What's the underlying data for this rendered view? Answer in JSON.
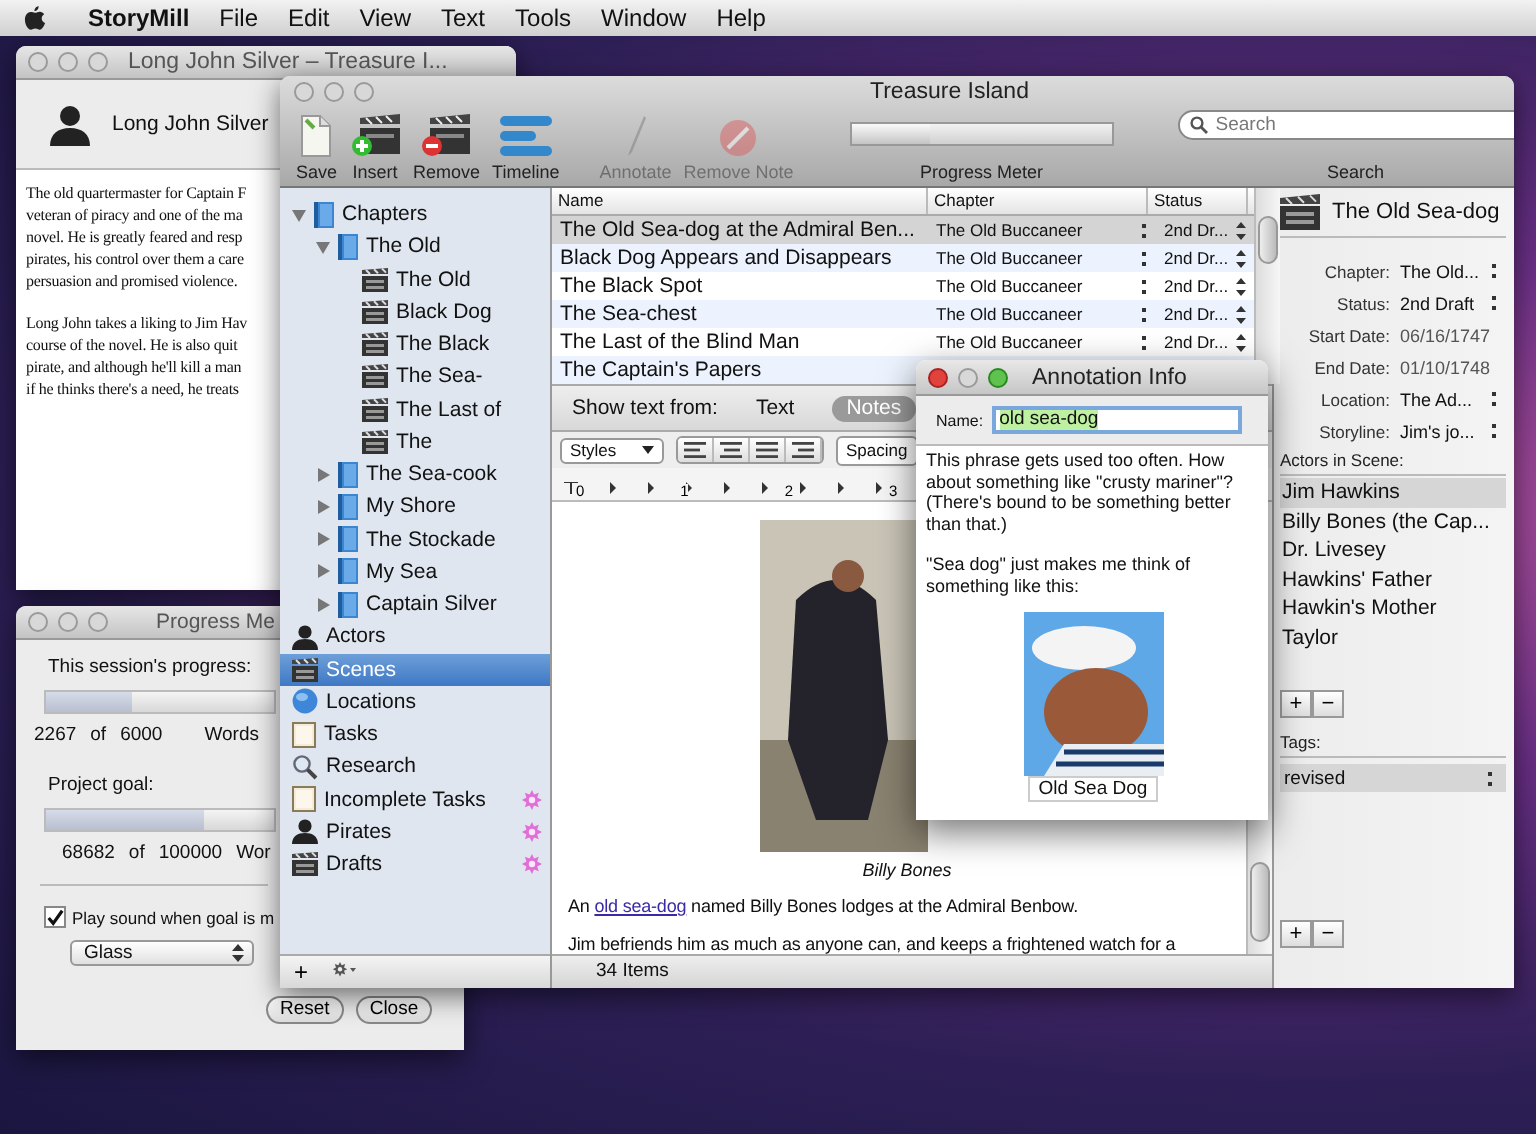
{
  "menu_bar": {
    "app": "StoryMill",
    "items": [
      "File",
      "Edit",
      "View",
      "Text",
      "Tools",
      "Window",
      "Help"
    ]
  },
  "actor_window": {
    "title": "Long John Silver – Treasure I...",
    "name": "Long John Silver",
    "paragraphs": [
      [
        "The old quartermaster for Captain F",
        "veteran of piracy and one of the ma",
        "novel.  He is greatly feared and resp",
        "pirates, his control over them a care",
        "persuasion and promised violence."
      ],
      [
        "Long John takes a liking to Jim Hav",
        "course of the novel.  He is also quit",
        "pirate, and although he'll kill a man",
        "if he thinks there's a need, he treats"
      ]
    ]
  },
  "progress_window": {
    "title": "Progress Me",
    "session_label": "This session's progress:",
    "session": {
      "level": 0.38,
      "count": "2267",
      "of": "of",
      "total": "6000",
      "unit": "Words"
    },
    "goal_label": "Project goal:",
    "goal": {
      "level": 0.69,
      "count": "68682",
      "of": "of",
      "total": "100000",
      "unit": "Wor"
    },
    "sound": {
      "label": "Play sound when goal is m",
      "checked": true
    },
    "sound_menu": "Glass",
    "buttons": [
      "Reset",
      "Close"
    ]
  },
  "main_window": {
    "title": "Treasure Island",
    "toolbar": [
      {
        "label": "Save",
        "kind": "save",
        "disabled": false
      },
      {
        "label": "Insert",
        "kind": "insert",
        "disabled": false
      },
      {
        "label": "Remove",
        "kind": "remove",
        "disabled": false
      },
      {
        "label": "Timeline",
        "kind": "timeline",
        "disabled": false
      },
      {
        "label": "Annotate",
        "kind": "annotate",
        "disabled": true
      },
      {
        "label": "Remove Note",
        "kind": "remove_note",
        "disabled": true
      }
    ],
    "progress": {
      "label": "Progress Meter",
      "level": 0.3
    },
    "search": {
      "placeholder": "Search",
      "label": "Search"
    }
  },
  "sidebar": {
    "items": [
      {
        "label": "Chapters",
        "kind": "book",
        "expanded": true,
        "selected": false,
        "badge": false,
        "children": [
          {
            "label": "The Old",
            "kind": "book",
            "expanded": true,
            "selected": false,
            "badge": false,
            "children": [
              {
                "label": "The Old",
                "kind": "clapper",
                "selected": false,
                "badge": false
              },
              {
                "label": "Black Dog",
                "kind": "clapper",
                "selected": false,
                "badge": false
              },
              {
                "label": "The Black",
                "kind": "clapper",
                "selected": false,
                "badge": false
              },
              {
                "label": "The Sea-",
                "kind": "clapper",
                "selected": false,
                "badge": false
              },
              {
                "label": "The Last of",
                "kind": "clapper",
                "selected": false,
                "badge": false
              },
              {
                "label": "The",
                "kind": "clapper",
                "selected": false,
                "badge": false
              }
            ]
          },
          {
            "label": "The Sea-cook",
            "kind": "book",
            "expanded": false,
            "selected": false,
            "badge": false
          },
          {
            "label": "My Shore",
            "kind": "book",
            "expanded": false,
            "selected": false,
            "badge": false
          },
          {
            "label": "The Stockade",
            "kind": "book",
            "expanded": false,
            "selected": false,
            "badge": false
          },
          {
            "label": "My Sea",
            "kind": "book",
            "expanded": false,
            "selected": false,
            "badge": false
          },
          {
            "label": "Captain Silver",
            "kind": "book",
            "expanded": false,
            "selected": false,
            "badge": false
          }
        ]
      },
      {
        "label": "Actors",
        "kind": "person",
        "selected": false,
        "badge": false
      },
      {
        "label": "Scenes",
        "kind": "clapper",
        "selected": true,
        "badge": false
      },
      {
        "label": "Locations",
        "kind": "globe",
        "selected": false,
        "badge": false
      },
      {
        "label": "Tasks",
        "kind": "note",
        "selected": false,
        "badge": false
      },
      {
        "label": "Research",
        "kind": "magnifier",
        "selected": false,
        "badge": false
      },
      {
        "label": "Incomplete Tasks",
        "kind": "note",
        "selected": false,
        "badge": true
      },
      {
        "label": "Pirates",
        "kind": "person",
        "selected": false,
        "badge": true
      },
      {
        "label": "Drafts",
        "kind": "clapper",
        "selected": false,
        "badge": true
      }
    ],
    "add_button": "+"
  },
  "table": {
    "columns": [
      "Name",
      "Chapter",
      "Status"
    ],
    "rows": [
      {
        "name": "The Old Sea-dog at the Admiral Ben...",
        "chapter": "The Old Buccaneer",
        "status": "2nd Dr...",
        "selected": true
      },
      {
        "name": "Black Dog Appears and Disappears",
        "chapter": "The Old Buccaneer",
        "status": "2nd Dr...",
        "selected": false
      },
      {
        "name": "The Black Spot",
        "chapter": "The Old Buccaneer",
        "status": "2nd Dr...",
        "selected": false
      },
      {
        "name": "The Sea-chest",
        "chapter": "The Old Buccaneer",
        "status": "2nd Dr...",
        "selected": false
      },
      {
        "name": "The Last of the Blind Man",
        "chapter": "The Old Buccaneer",
        "status": "2nd Dr...",
        "selected": false
      },
      {
        "name": "The Captain's Papers",
        "selected": false
      }
    ]
  },
  "editor": {
    "show_text_from": "Show text from:",
    "modes": [
      {
        "label": "Text",
        "selected": false
      },
      {
        "label": "Notes",
        "selected": true
      }
    ],
    "styles": "Styles",
    "spacing": "Spacing",
    "ruler_labels": [
      "0",
      "1",
      "2",
      "3"
    ],
    "caption": "Billy Bones",
    "link_paragraph": {
      "before": "An ",
      "link": "old sea-dog",
      "after": " named Billy Bones lodges at the Admiral Benbow."
    },
    "paragraphs": [
      "Jim befriends him as much as anyone can, and keeps a frightened watch for a"
    ]
  },
  "status_bar": "34 Items",
  "annotation": {
    "title": "Annotation Info",
    "name_label": "Name:",
    "name": "old sea-dog",
    "paragraphs": [
      "This phrase gets used too often.  How about something like \"crusty mariner\"? (There's bound to be something better than that.)",
      "\"Sea dog\" just makes me think of something like this:"
    ],
    "picture_caption": "Old Sea Dog"
  },
  "inspector": {
    "title": "The Old Sea-dog",
    "fields": [
      {
        "label": "Chapter:",
        "value": "The Old...",
        "kind": "popup"
      },
      {
        "label": "Status:",
        "value": "2nd Draft",
        "kind": "popup"
      },
      {
        "label": "Start Date:",
        "value": "06/16/1747",
        "kind": "date"
      },
      {
        "label": "End Date:",
        "value": "01/10/1748",
        "kind": "date"
      },
      {
        "label": "Location:",
        "value": "The Ad...",
        "kind": "popup"
      },
      {
        "label": "Storyline:",
        "value": "Jim's jo...",
        "kind": "popup"
      }
    ],
    "actors_label": "Actors in Scene:",
    "actors": [
      {
        "name": "Jim Hawkins",
        "selected": true
      },
      {
        "name": "Billy Bones (the Cap...",
        "selected": false
      },
      {
        "name": "Dr. Livesey",
        "selected": false
      },
      {
        "name": "Hawkins' Father",
        "selected": false
      },
      {
        "name": "Hawkin's Mother",
        "selected": false
      },
      {
        "name": "Taylor",
        "selected": false
      }
    ],
    "add": "+",
    "remove": "−",
    "tags_label": "Tags:",
    "tag": "revised"
  }
}
